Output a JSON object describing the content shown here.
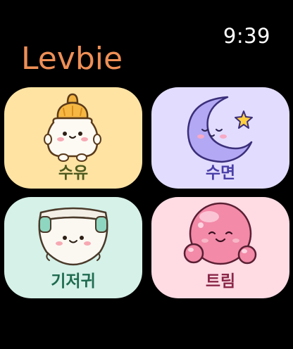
{
  "status_bar": {
    "time": "9:39"
  },
  "app": {
    "title": "Levbie"
  },
  "tiles": [
    {
      "key": "feed",
      "label": "수유",
      "bg": "#ffe3a3",
      "label_color": "#4d5a1f",
      "icon": "baby-bottle-icon"
    },
    {
      "key": "sleep",
      "label": "수면",
      "bg": "#e2dcff",
      "label_color": "#4a3fa8",
      "icon": "moon-star-icon"
    },
    {
      "key": "diaper",
      "label": "기저귀",
      "bg": "#d5f1e8",
      "label_color": "#1f6b4f",
      "icon": "diaper-icon"
    },
    {
      "key": "burp",
      "label": "트림",
      "bg": "#ffdbe4",
      "label_color": "#8a2748",
      "icon": "burp-bubble-icon"
    }
  ],
  "colors": {
    "background": "#000000",
    "title": "#ee8f56",
    "time": "#ffffff"
  }
}
